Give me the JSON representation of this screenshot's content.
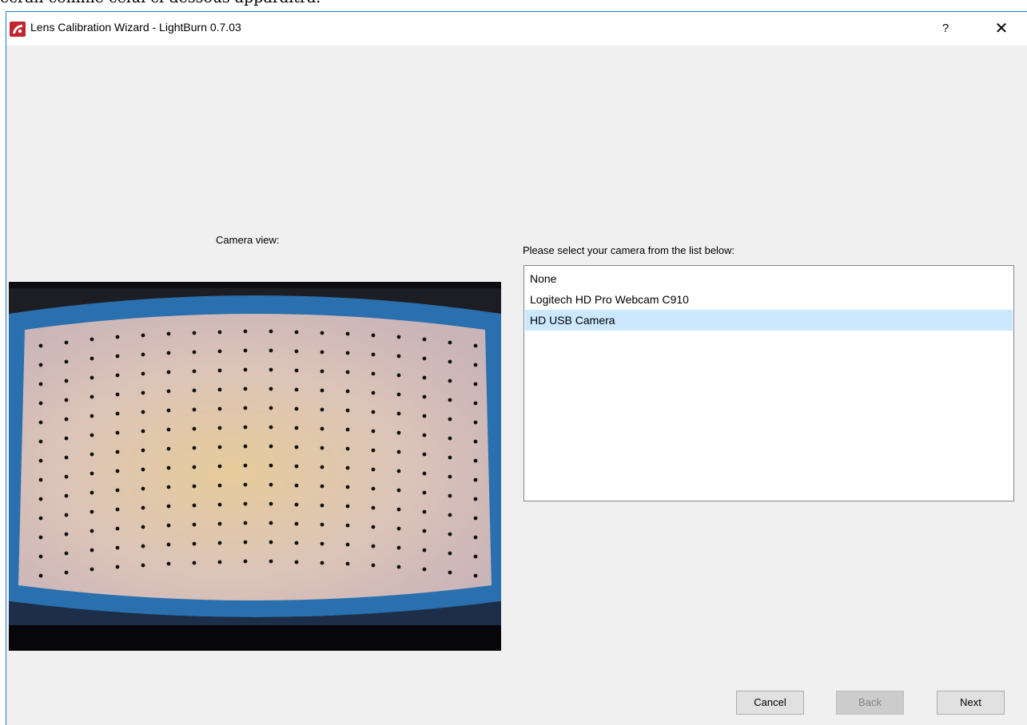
{
  "background_caption": "écran comme celui ci-dessous apparaîtra.",
  "window": {
    "title": "Lens Calibration Wizard - LightBurn 0.7.03",
    "help_label": "?",
    "close_label": "✕"
  },
  "camera_view": {
    "label": "Camera view:"
  },
  "camera_select": {
    "label": "Please select your camera from the list below:",
    "items": [
      "None",
      "Logitech HD Pro Webcam C910",
      "HD USB Camera"
    ],
    "selected_index": 2
  },
  "buttons": {
    "cancel": "Cancel",
    "back": "Back",
    "next": "Next"
  },
  "colors": {
    "accent_border": "#1e79c8",
    "selection": "#cce8ff",
    "frame_blue": "#2a6fae"
  }
}
